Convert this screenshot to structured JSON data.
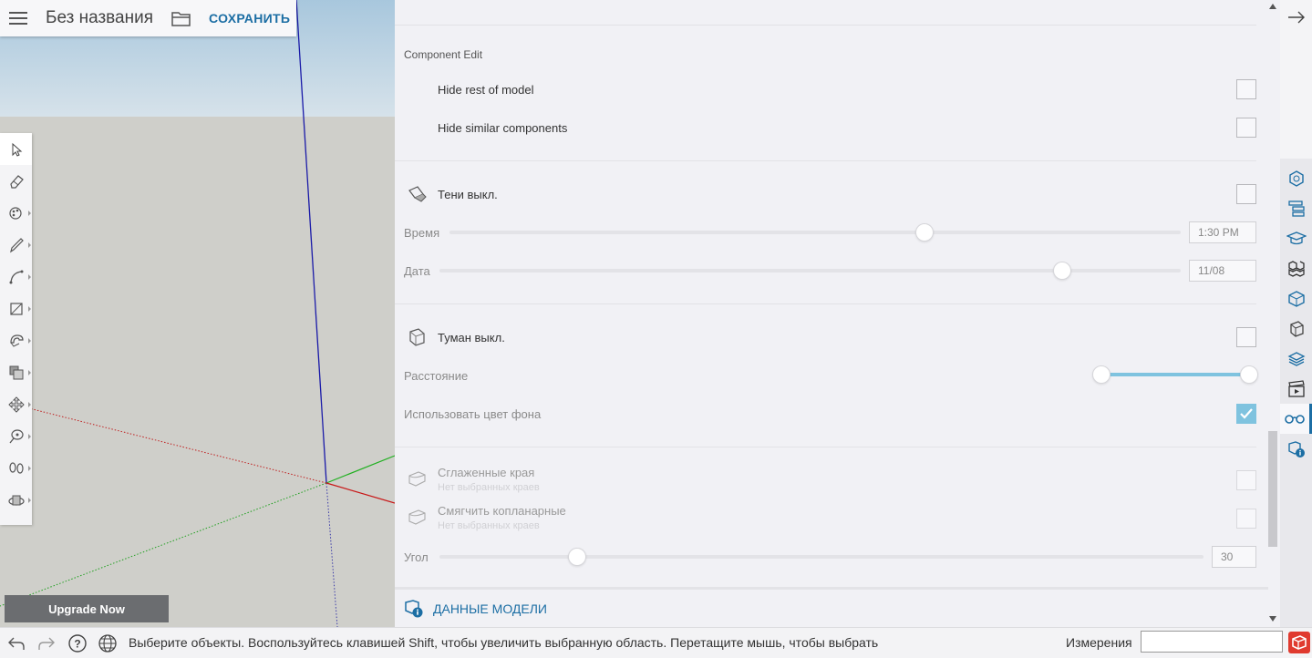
{
  "header": {
    "title": "Без названия",
    "save_label": "СОХРАНИТЬ"
  },
  "upgrade": {
    "label": "Upgrade Now"
  },
  "toolbar": {
    "tools": [
      "select-tool",
      "eraser-tool",
      "paint-bucket-tool",
      "pencil-tool",
      "arc-tool",
      "rectangle-tool",
      "push-pull-tool",
      "offset-tool",
      "move-tool",
      "tape-measure-tool",
      "footprints-tool",
      "orbit-tool"
    ]
  },
  "panel": {
    "component_edit": {
      "heading": "Component Edit",
      "hide_rest_label": "Hide rest of model",
      "hide_rest_checked": false,
      "hide_similar_label": "Hide similar components",
      "hide_similar_checked": false
    },
    "shadows": {
      "label": "Тени выкл.",
      "checked": false,
      "time_label": "Время",
      "time_value": "1:30 PM",
      "time_fraction": 0.65,
      "date_label": "Дата",
      "date_value": "11/08",
      "date_fraction": 0.84
    },
    "fog": {
      "label": "Туман выкл.",
      "checked": false,
      "distance_label": "Расстояние",
      "distance_start": 0.0,
      "distance_end": 1.0,
      "use_bg_label": "Использовать цвет фона",
      "use_bg_checked": true
    },
    "edges": {
      "smooth_label": "Сглаженные края",
      "smooth_sub": "Нет выбранных краев",
      "soften_label": "Смягчить копланарные",
      "soften_sub": "Нет выбранных краев",
      "angle_label": "Угол",
      "angle_value": "30",
      "angle_fraction": 0.18
    },
    "model_data_label": "ДАННЫЕ МОДЕЛИ"
  },
  "tray": {
    "items": [
      "entity-info",
      "outliner",
      "instructor",
      "components",
      "materials",
      "styles",
      "tags",
      "scenes",
      "display",
      "model-info"
    ],
    "active": "display"
  },
  "status": {
    "text": "Выберите объекты. Воспользуйтесь клавишей Shift, чтобы увеличить выбранную область. Перетащите мышь, чтобы выбрать",
    "measure_label": "Измерения",
    "measure_value": ""
  },
  "colors": {
    "accent": "#1c6ea4",
    "checkbox_checked": "#7fc3df",
    "axis_blue": "#0000c8",
    "axis_red": "#c80000",
    "axis_green": "#00b400"
  }
}
